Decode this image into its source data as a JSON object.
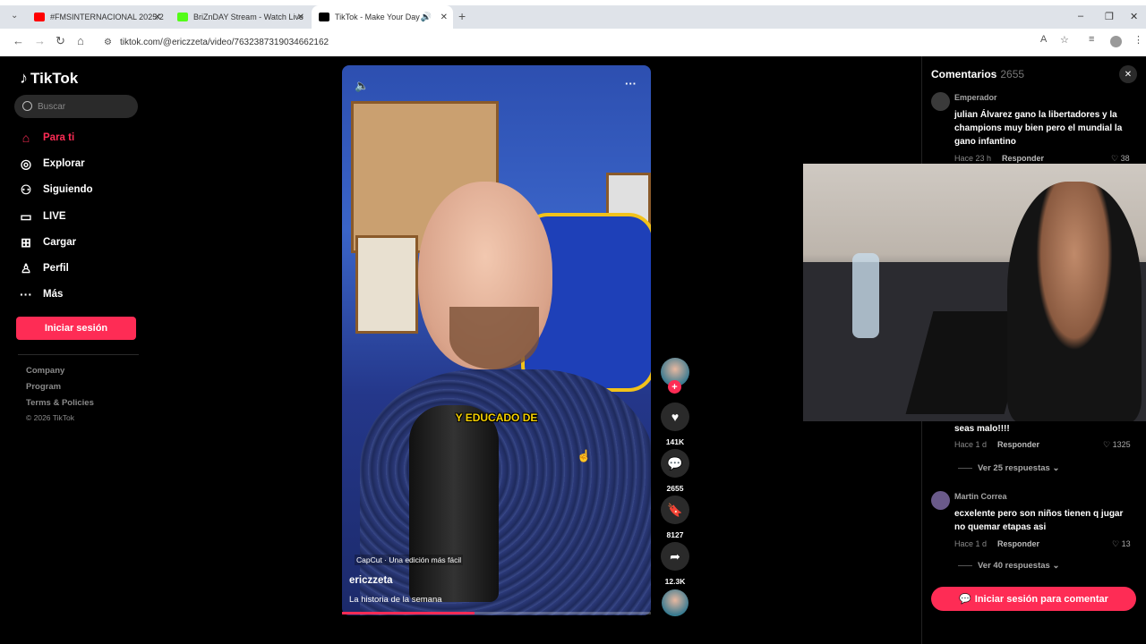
{
  "browser": {
    "tabs": [
      {
        "title": "#FMSINTERNACIONAL 2025/2",
        "fav_color": "#ff0000"
      },
      {
        "title": "BriZnDAY Stream - Watch Live",
        "fav_color": "#53fc18"
      },
      {
        "title": "TikTok - Make Your Day",
        "fav_color": "#000000"
      }
    ],
    "url": "tiktok.com/@ericzzeta/video/7632387319034662162"
  },
  "sidebar": {
    "logo": "TikTok",
    "search_placeholder": "Buscar",
    "nav": [
      {
        "label": "Para ti",
        "icon": "home-icon"
      },
      {
        "label": "Explorar",
        "icon": "compass-icon"
      },
      {
        "label": "Siguiendo",
        "icon": "following-icon"
      },
      {
        "label": "LIVE",
        "icon": "live-icon"
      },
      {
        "label": "Cargar",
        "icon": "upload-icon"
      },
      {
        "label": "Perfil",
        "icon": "profile-icon"
      },
      {
        "label": "Más",
        "icon": "more-icon"
      }
    ],
    "login": "Iniciar sesión",
    "footer": [
      "Company",
      "Program",
      "Terms & Policies"
    ],
    "copyright": "© 2026 TikTok"
  },
  "video": {
    "subtitle": "Y EDUCADO DE",
    "capcut": "CapCut · Una edición más fácil",
    "author": "ericzzeta",
    "description": "La historia de la semana",
    "progress": 0.43
  },
  "actions": {
    "likes": "141K",
    "comments": "2655",
    "saves": "8127",
    "shares": "12.3K"
  },
  "comments": {
    "title": "Comentarios",
    "count": "2655",
    "items": [
      {
        "name": "Emperador",
        "text": "julian Álvarez gano la libertadores y la champions muy bien pero el mundial la gano infantino",
        "time": "Hace 23 h",
        "reply": "Responder",
        "likes": "38"
      },
      {
        "name": "",
        "text": "seas malo!!!!",
        "time": "Hace 1 d",
        "reply": "Responder",
        "likes": "1325",
        "more": "Ver 25 respuestas"
      },
      {
        "name": "Martin Correa",
        "text": "ecxelente pero son niños tienen q jugar no quemar etapas asi",
        "time": "Hace 1 d",
        "reply": "Responder",
        "likes": "13",
        "more": "Ver 40 respuestas"
      }
    ],
    "login_button": "Iniciar sesión para comentar"
  }
}
